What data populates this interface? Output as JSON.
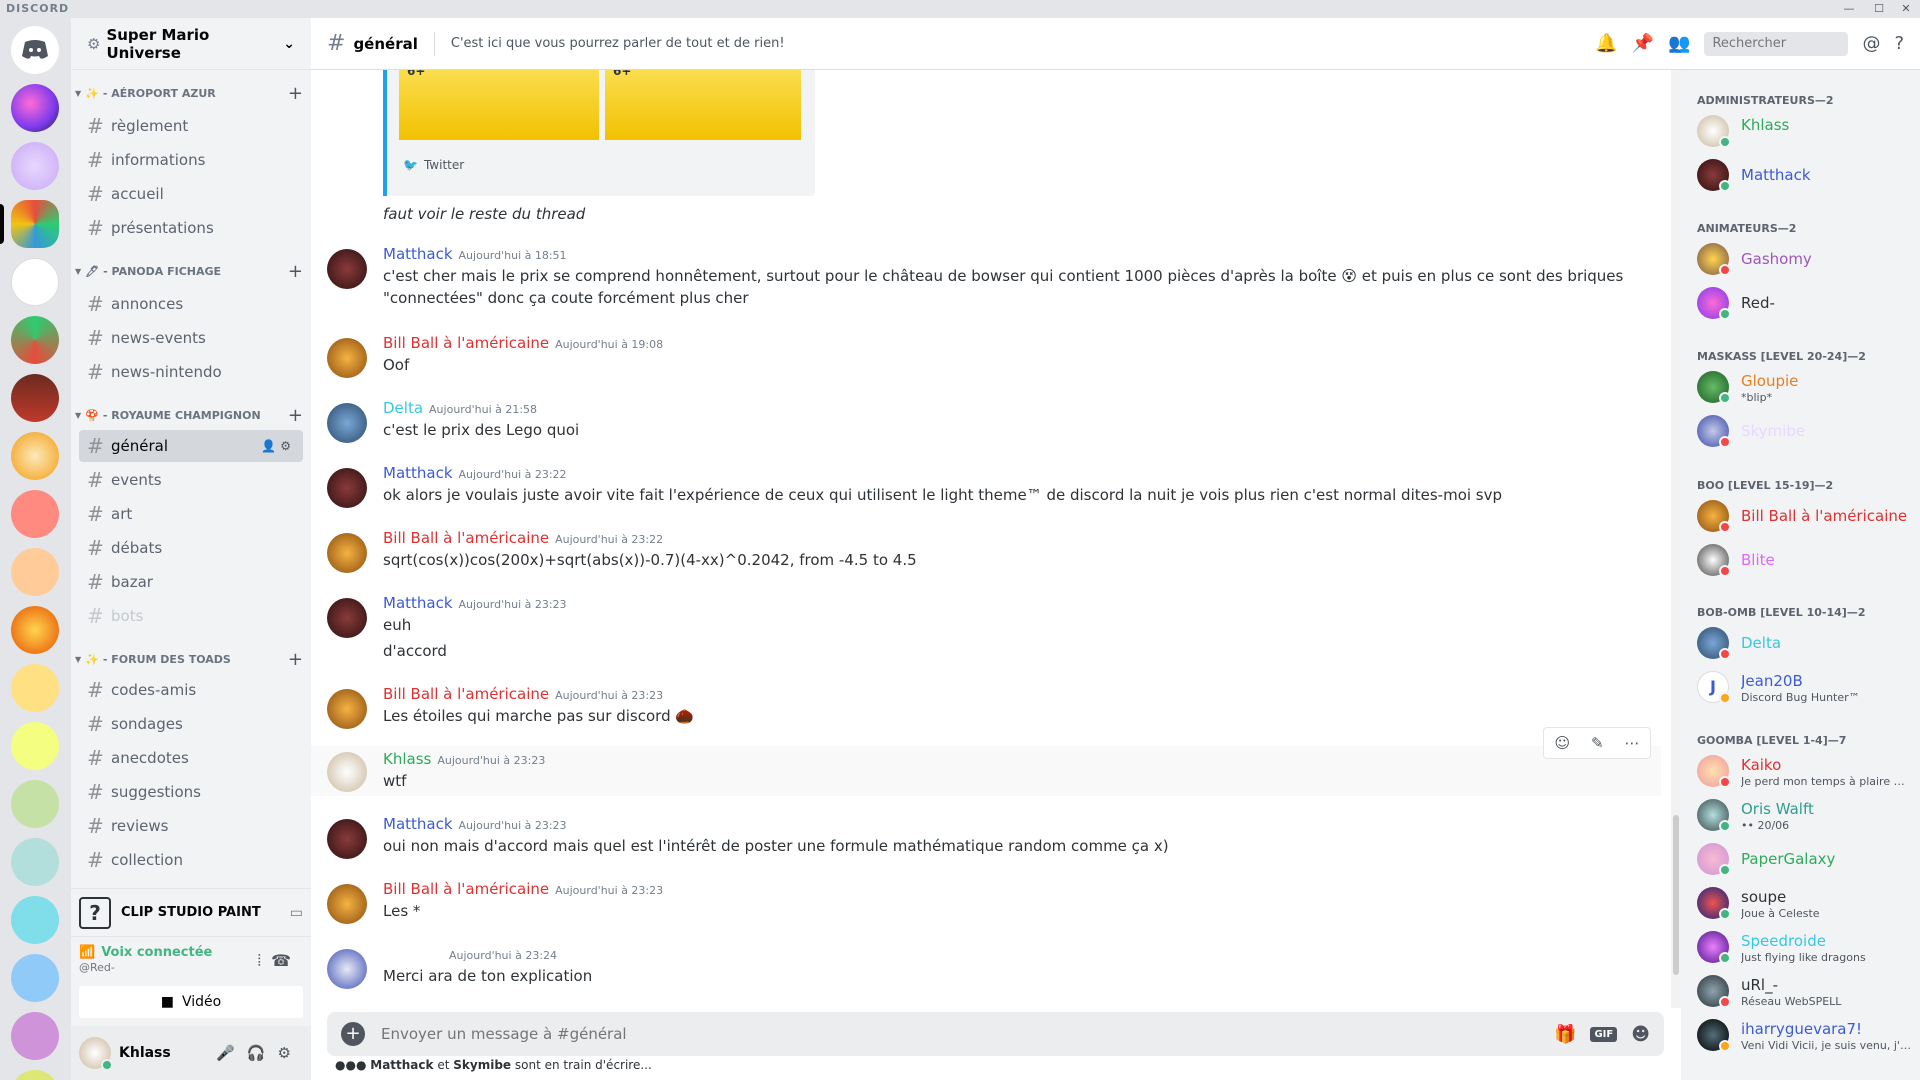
{
  "app": {
    "title": "DISCORD"
  },
  "window": {
    "minimize": "—",
    "maximize": "☐",
    "close": "✕"
  },
  "server": {
    "name": "Super Mario Universe"
  },
  "sidebar": {
    "categories": [
      {
        "emoji": "✨",
        "name": "- AÉROPORT AZUR",
        "channels": [
          "règlement",
          "informations",
          "accueil",
          "présentations"
        ]
      },
      {
        "emoji": "🖊",
        "name": "- PANODA FICHAGE",
        "channels": [
          "annonces",
          "news-events",
          "news-nintendo"
        ]
      },
      {
        "emoji": "🍄",
        "name": "- ROYAUME CHAMPIGNON",
        "channels": [
          "général",
          "events",
          "art",
          "débats",
          "bazar",
          "bots"
        ]
      },
      {
        "emoji": "✨",
        "name": "- FORUM DES TOADS",
        "channels": [
          "codes-amis",
          "sondages",
          "anecdotes",
          "suggestions",
          "reviews",
          "collection"
        ]
      }
    ],
    "activity": {
      "icon": "?",
      "name": "CLIP STUDIO PAINT"
    },
    "voice": {
      "status": "Voix connectée",
      "server": "@Red-",
      "video": "Vidéo"
    },
    "user": {
      "name": "Khlass"
    }
  },
  "channel": {
    "name": "général",
    "topic": "C'est ici que vous pourrez parler de tout et de rien!",
    "search_placeholder": "Rechercher"
  },
  "embed": {
    "provider": "Twitter",
    "box_text": "6+"
  },
  "messages": [
    {
      "author": "",
      "time": "",
      "text": "faut voir le reste du thread",
      "continued": true,
      "italic": true
    },
    {
      "author": "Matthack",
      "color": "#3b5bd6",
      "time": "Aujourd'hui à 18:51",
      "text": "c'est cher mais le prix se comprend honnêtement, surtout pour le château de bowser qui contient 1000 pièces d'après la boîte 😵 et puis en plus ce sont des briques \"connectées\" donc ça coute forcément plus cher"
    },
    {
      "author": "Bill Ball à l'américaine",
      "color": "#e03131",
      "time": "Aujourd'hui à 19:08",
      "text": "Oof"
    },
    {
      "author": "Delta",
      "color": "#33c9e0",
      "time": "Aujourd'hui à 21:58",
      "text": "c'est le prix des Lego quoi"
    },
    {
      "author": "Matthack",
      "color": "#3b5bd6",
      "time": "Aujourd'hui à 23:22",
      "text": "ok alors je voulais juste avoir vite fait l'expérience de ceux qui utilisent le light theme™ de discord la nuit je vois plus rien c'est normal dites-moi svp"
    },
    {
      "author": "Bill Ball à l'américaine",
      "color": "#e03131",
      "time": "Aujourd'hui à 23:22",
      "text": "sqrt(cos(x))cos(200x)+sqrt(abs(x))-0.7)(4-xx)^0.2042, from -4.5 to 4.5"
    },
    {
      "author": "Matthack",
      "color": "#3b5bd6",
      "time": "Aujourd'hui à 23:23",
      "text": "euh",
      "text2": "d'accord"
    },
    {
      "author": "Bill Ball à l'américaine",
      "color": "#e03131",
      "time": "Aujourd'hui à 23:23",
      "text": "Les étoiles qui marche pas sur discord 🌰"
    },
    {
      "author": "Khlass",
      "color": "#2eab59",
      "time": "Aujourd'hui à 23:23",
      "text": "wtf"
    },
    {
      "author": "Matthack",
      "color": "#3b5bd6",
      "time": "Aujourd'hui à 23:23",
      "text": "oui non mais d'accord mais quel est l'intérêt de poster une formule mathématique random comme ça x)"
    },
    {
      "author": "Bill Ball à l'américaine",
      "color": "#e03131",
      "time": "Aujourd'hui à 23:23",
      "text": "Les *"
    },
    {
      "author": "",
      "color": "#ffffff",
      "time": "Aujourd'hui à 23:24",
      "text": "Merci ara de ton explication"
    }
  ],
  "hover_actions": [
    "react",
    "edit",
    "more"
  ],
  "composer": {
    "placeholder": "Envoyer un message à #général",
    "add": "+",
    "gif": "GIF"
  },
  "typing": {
    "users": [
      "Matthack",
      "Skymibe"
    ],
    "joiner": "et",
    "suffix": "sont en train d'écrire..."
  },
  "members": [
    {
      "role": "ADMINISTRATEURS—2",
      "list": [
        {
          "name": "Khlass",
          "color": "#2eab59",
          "status": "online",
          "sub": ""
        },
        {
          "name": "Matthack",
          "color": "#3b5bd6",
          "status": "online",
          "sub": ""
        }
      ]
    },
    {
      "role": "ANIMATEURS—2",
      "list": [
        {
          "name": "Gashomy",
          "color": "#9b59b6",
          "status": "dnd",
          "sub": ""
        },
        {
          "name": "Red-",
          "color": "#2e3338",
          "status": "online",
          "sub": ""
        }
      ]
    },
    {
      "role": "MASKASS [LEVEL 20-24]—2",
      "list": [
        {
          "name": "Gloupie",
          "color": "#e67e22",
          "status": "online",
          "sub": "*blip*"
        },
        {
          "name": "Skymibe",
          "color": "#e8d8ff",
          "status": "dnd",
          "sub": ""
        }
      ]
    },
    {
      "role": "BOO [LEVEL 15-19]—2",
      "list": [
        {
          "name": "Bill Ball à l'américaine",
          "color": "#e03131",
          "status": "dnd",
          "sub": ""
        },
        {
          "name": "Blite",
          "color": "#e066ff",
          "status": "dnd",
          "sub": ""
        }
      ]
    },
    {
      "role": "BOB-OMB [LEVEL 10-14]—2",
      "list": [
        {
          "name": "Delta",
          "color": "#33c9e0",
          "status": "dnd",
          "sub": ""
        },
        {
          "name": "Jean20B",
          "color": "#3b5bd6",
          "status": "idle",
          "sub": "Discord Bug Hunter™"
        }
      ]
    },
    {
      "role": "GOOMBA [LEVEL 1-4]—7",
      "list": [
        {
          "name": "Kaiko",
          "color": "#e03131",
          "status": "dnd",
          "sub": "Je perd mon temps à plaire au..."
        },
        {
          "name": "Oris Walft",
          "color": "#2e9e8f",
          "status": "online",
          "sub": "•• 20/06"
        },
        {
          "name": "PaperGalaxy",
          "color": "#2eab59",
          "status": "online",
          "sub": ""
        },
        {
          "name": "soupe",
          "color": "#2e3338",
          "status": "online",
          "sub": "Joue à Celeste"
        },
        {
          "name": "Speedroide",
          "color": "#33c9e0",
          "status": "online",
          "sub": "Just flying like dragons"
        },
        {
          "name": "uRl_-",
          "color": "#2e3338",
          "status": "dnd",
          "sub": "Réseau WebSPELL"
        },
        {
          "name": "iharryguevara7!",
          "color": "#3b5bd6",
          "status": "idle",
          "sub": "Veni Vidi Vicii, je suis venu, j'ai..."
        }
      ]
    }
  ],
  "colors": {
    "online": "#43b581",
    "dnd": "#f04747",
    "idle": "#faa61a",
    "accent": "#7289da"
  }
}
